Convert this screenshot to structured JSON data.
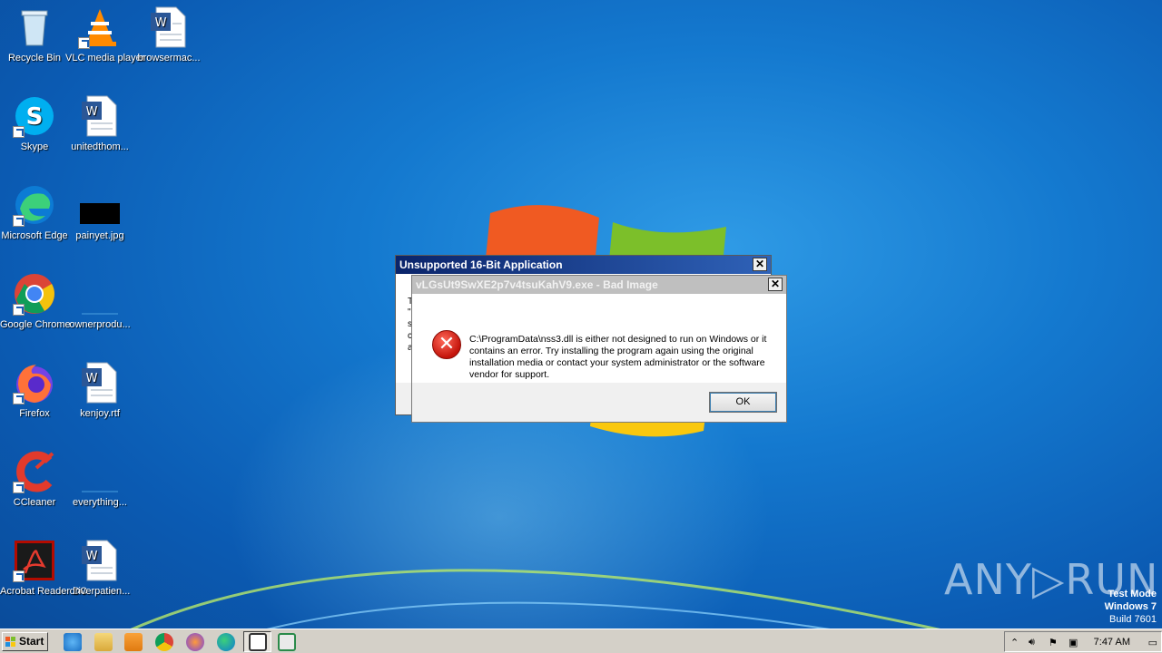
{
  "desktop": {
    "icons": [
      {
        "label": "Recycle Bin",
        "icon": "recycle-bin-icon"
      },
      {
        "label": "VLC media player",
        "icon": "vlc-icon"
      },
      {
        "label": "browsermac...",
        "icon": "word-document-icon"
      },
      {
        "label": "Skype",
        "icon": "skype-icon"
      },
      {
        "label": "unitedthom...",
        "icon": "word-document-icon"
      },
      {
        "label": "Microsoft Edge",
        "icon": "edge-icon"
      },
      {
        "label": "painyet.jpg",
        "icon": "image-file-icon"
      },
      {
        "label": "Google Chrome",
        "icon": "chrome-icon"
      },
      {
        "label": "ownerprodu...",
        "icon": "blank-file-icon"
      },
      {
        "label": "Firefox",
        "icon": "firefox-icon"
      },
      {
        "label": "kenjoy.rtf",
        "icon": "word-document-icon"
      },
      {
        "label": "CCleaner",
        "icon": "ccleaner-icon"
      },
      {
        "label": "everything...",
        "icon": "blank-file-icon"
      },
      {
        "label": "Acrobat Reader DC",
        "icon": "acrobat-icon"
      },
      {
        "label": "driverpatien...",
        "icon": "word-document-icon"
      }
    ]
  },
  "dialog_back": {
    "title": "Unsupported 16-Bit Application",
    "close": "✕",
    "partial_lines": [
      "T",
      "\"",
      "s",
      "c",
      "a"
    ]
  },
  "dialog_front": {
    "title": "vLGsUt9SwXE2p7v4tsuKahV9.exe - Bad Image",
    "close": "✕",
    "message": "C:\\ProgramData\\nss3.dll is either not designed to run on Windows or it contains an error. Try installing the program again using the original installation media or contact your system administrator or the software vendor for support.",
    "ok_label": "OK"
  },
  "watermark": "ANY▷RUN",
  "test_mode": {
    "line1": "Test Mode",
    "line2": "Windows 7",
    "line3": "Build 7601"
  },
  "taskbar": {
    "start_label": "Start",
    "pinned": [
      "ie-icon",
      "explorer-icon",
      "media-player-icon",
      "chrome-icon",
      "firefox-icon",
      "edge-icon",
      "program-icon",
      "program-window-icon"
    ],
    "clock": "7:47 AM"
  }
}
